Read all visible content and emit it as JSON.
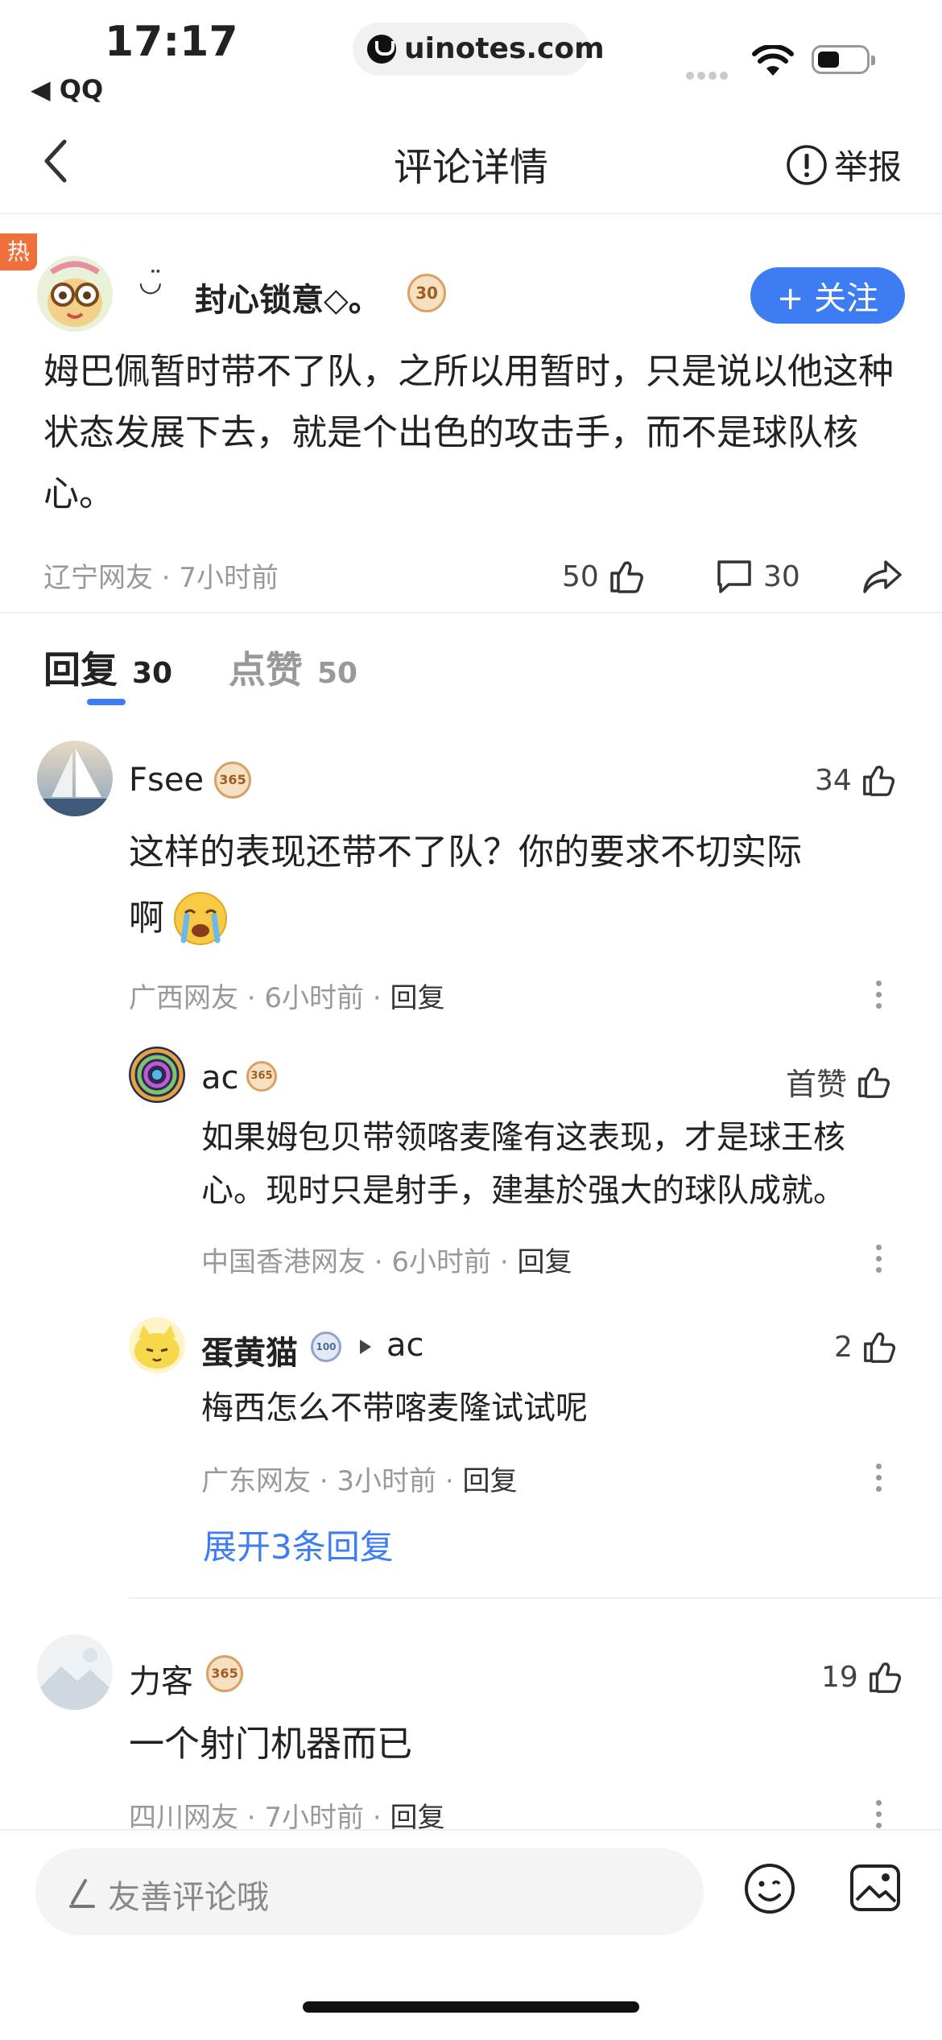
{
  "status_bar": {
    "time": "17:17",
    "back_app": "◀ QQ",
    "url": "uinotes.com"
  },
  "nav": {
    "title": "评论详情",
    "report_label": "举报"
  },
  "main_comment": {
    "hot_badge": "热",
    "author_decor": "◡̈",
    "author": "封心锁意◇。",
    "level": "30",
    "follow_label": "+ 关注",
    "text": "姆巴佩暂时带不了队，之所以用暂时，只是说以他这种状态发展下去，就是个出色的攻击手，而不是球队核心。",
    "meta": "辽宁网友 · 7小时前",
    "likes": "50",
    "comments": "30"
  },
  "tabs": [
    {
      "label": "回复",
      "count": "30"
    },
    {
      "label": "点赞",
      "count": "50"
    }
  ],
  "replies": [
    {
      "name": "Fsee",
      "level": "365",
      "likes": "34",
      "text_line1": "这样的表现还带不了队？你的要求不切实际",
      "text_line2": "啊",
      "meta": "广西网友 · 6小时前 · ",
      "reply_label": "回复"
    },
    {
      "name": "ac",
      "level": "365",
      "likes": "首赞",
      "text": "如果姆包贝带领喀麦隆有这表现，才是球王核心。现时只是射手，建基於强大的球队成就。",
      "meta": "中国香港网友 · 6小时前 · ",
      "reply_label": "回复"
    },
    {
      "name": "蛋黄猫",
      "level": "100",
      "reply_to": "ac",
      "likes": "2",
      "text": "梅西怎么不带喀麦隆试试呢",
      "meta": "广东网友 · 3小时前 · ",
      "reply_label": "回复"
    },
    {
      "name": "力客",
      "level": "365",
      "likes": "19",
      "text": "一个射门机器而已",
      "meta": "四川网友 · 7小时前 · ",
      "reply_label": "回复"
    }
  ],
  "expand_label": "展开3条回复",
  "bottom_bar": {
    "placeholder": "友善评论哦"
  },
  "colors": {
    "accent": "#3d7cf2",
    "hot": "#f0703c",
    "muted": "#999999"
  }
}
